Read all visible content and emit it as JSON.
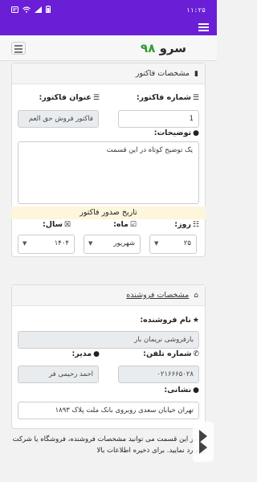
{
  "status_bar": {
    "time": "۱۱:۲۵"
  },
  "app_bar": {
    "brand_word": "سرو",
    "brand_number": "۹۸"
  },
  "invoice_card": {
    "header": "مشخصات فاکتور",
    "invoice_number_label": "شماره فاکتور:",
    "invoice_number_value": "1",
    "invoice_title_label": "عنوان فاکتور:",
    "invoice_title_value": "فاکتور فروش حق العم",
    "description_label": "توضیحات:",
    "description_value": "یک توضیح کوتاه در این قسمت",
    "issue_date_heading": "تاریخ صدور فاکتور",
    "day_label": "روز:",
    "day_value": "۲۵",
    "month_label": "ماه:",
    "month_value": "شهریور",
    "year_label": "سال:",
    "year_value": "۱۴۰۴"
  },
  "seller_card": {
    "header": "مشخصات فروشنده",
    "seller_name_label": "نام فروشنده:",
    "seller_name_value": "بارفروشی نریمان بار",
    "phone_label": "شماره تلفن:",
    "phone_value": "۰۲۱۶۶۶۵۰۲۸",
    "manager_label": "مدیر:",
    "manager_value": "احمد رحیمی فر",
    "address_label": "نشانی:",
    "address_value": "تهران خیابان سعدی روبروی بانک ملت پلاک ۱۸۹۳"
  },
  "note_text": "در این قسمت می توانید مشخصات فروشنده، فروشگاه یا شرکت را وارد نمایید. برای ذخیره اطلاعات بالا"
}
